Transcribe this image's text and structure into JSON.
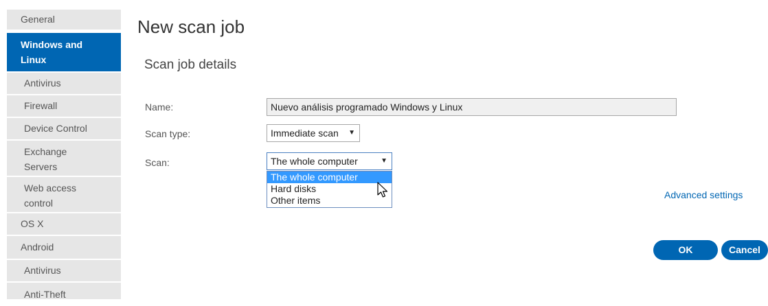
{
  "sidebar": {
    "items": [
      {
        "label": "General"
      },
      {
        "label": "Windows and Linux"
      },
      {
        "label": "Antivirus"
      },
      {
        "label": "Firewall"
      },
      {
        "label": "Device Control"
      },
      {
        "label": "Exchange Servers"
      },
      {
        "label": "Web access control"
      },
      {
        "label": "OS X"
      },
      {
        "label": "Android"
      },
      {
        "label": "Antivirus"
      },
      {
        "label": "Anti-Theft"
      }
    ]
  },
  "main": {
    "title": "New scan job",
    "section_title": "Scan job details",
    "name_label": "Name:",
    "name_value": "Nuevo análisis programado Windows y Linux",
    "scan_type_label": "Scan type:",
    "scan_type_value": "Immediate scan",
    "scan_label": "Scan:",
    "scan_value": "The whole computer",
    "scan_options": [
      "The whole computer",
      "Hard disks",
      "Other items"
    ],
    "advanced_settings": "Advanced settings",
    "ok_label": "OK",
    "cancel_label": "Cancel"
  },
  "colors": {
    "accent": "#0066b3",
    "sidebar_bg": "#e6e6e6",
    "selected_option": "#3399ff"
  }
}
